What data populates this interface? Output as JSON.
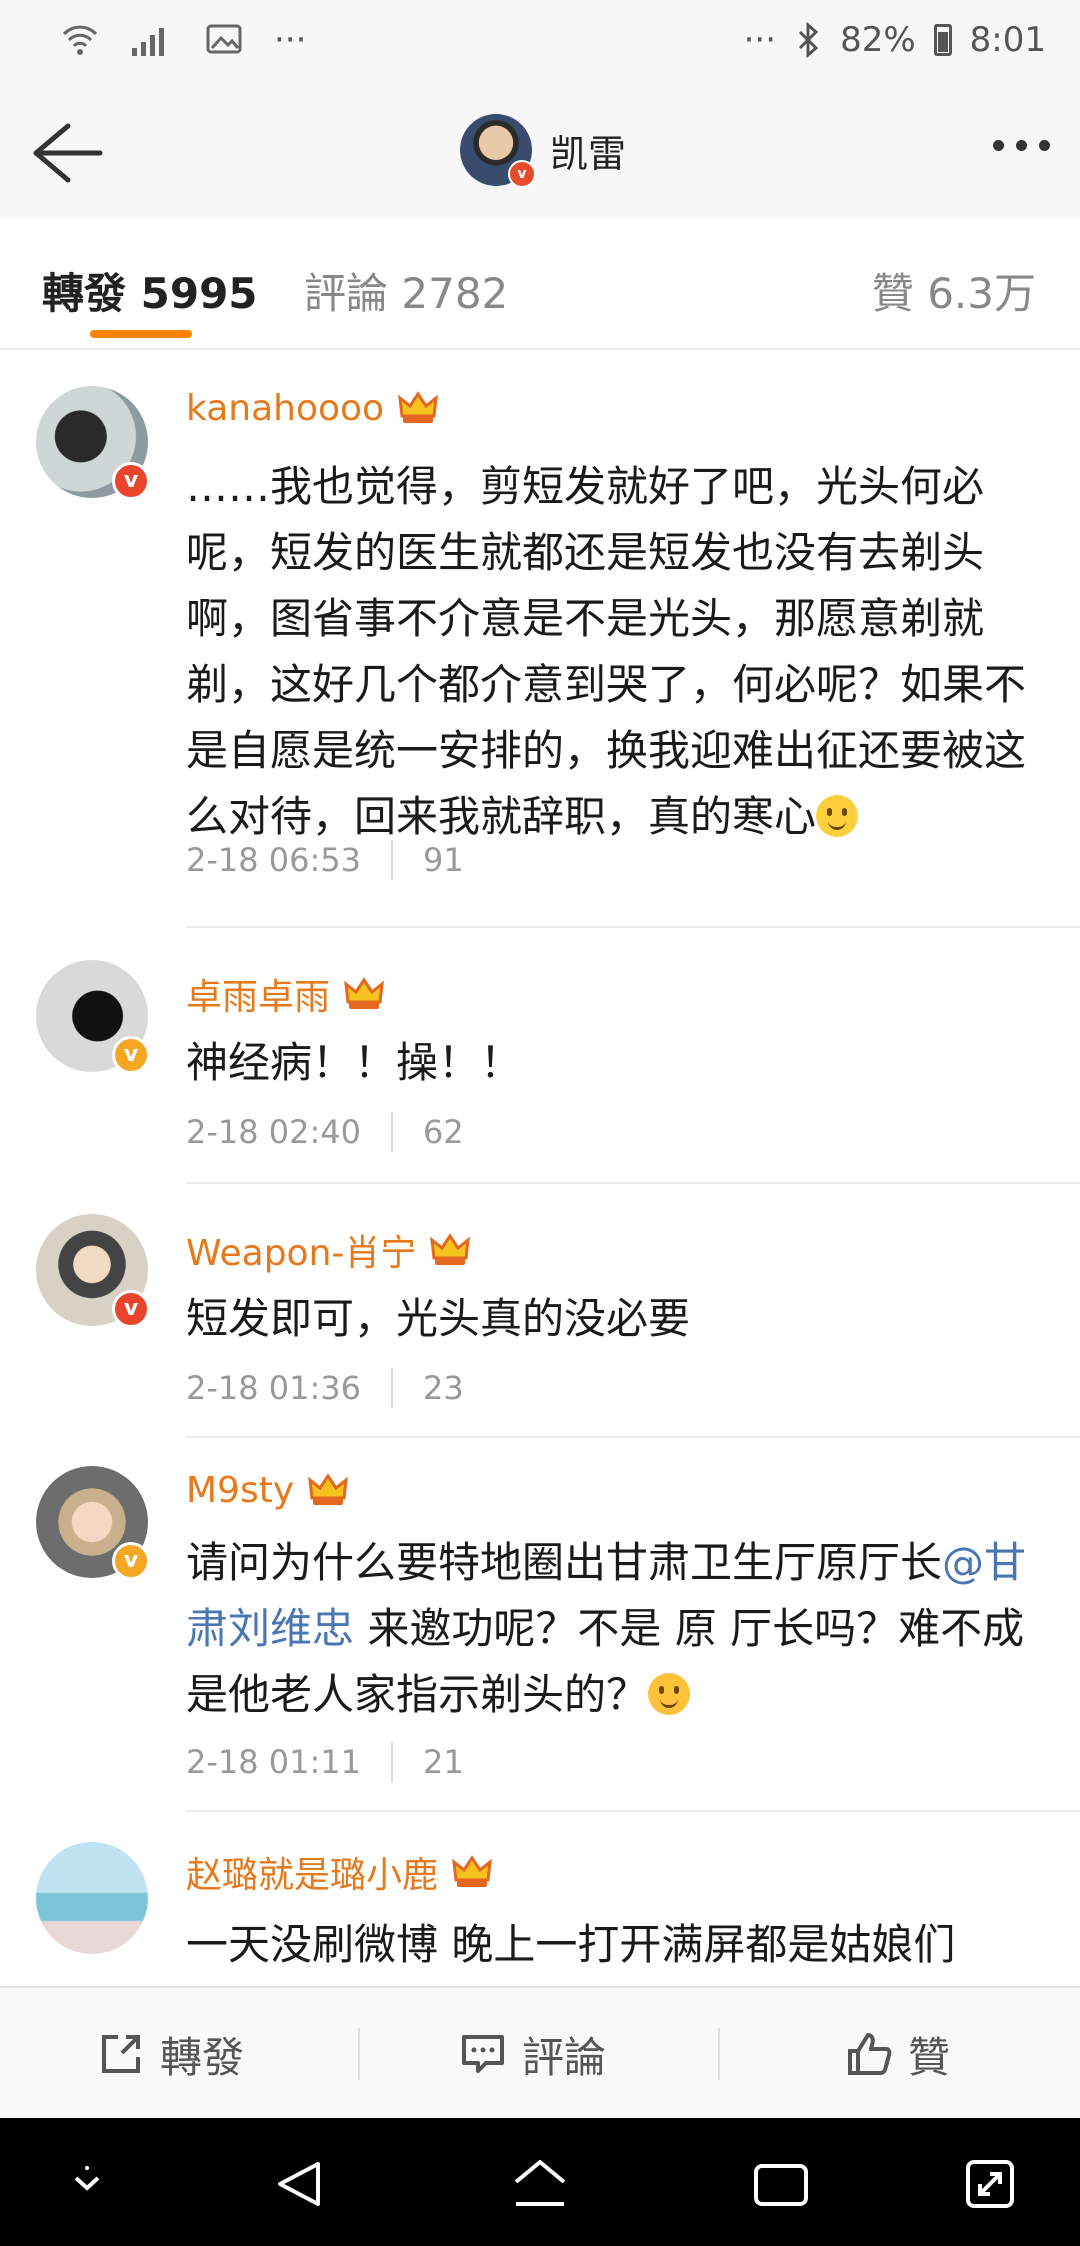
{
  "status_bar": {
    "battery": "82%",
    "time": "8:01",
    "left_dots": "···",
    "right_dots": "···"
  },
  "header": {
    "title": "凯雷"
  },
  "tabs": {
    "repost": {
      "label": "轉發",
      "count": "5995"
    },
    "comment": {
      "label": "評論",
      "count": "2782"
    },
    "like": {
      "label": "贊",
      "count": "6.3万"
    }
  },
  "comments": [
    {
      "name": "kanahoooo",
      "text": "……我也觉得，剪短发就好了吧，光头何必呢，短发的医生就都还是短发也没有去剃头啊，图省事不介意是不是光头，那愿意剃就剃，这好几个都介意到哭了，何必呢？如果不是自愿是统一安排的，换我迎难出征还要被这么对待，回来我就辞职，真的寒心",
      "time": "2-18 06:53",
      "likes": "91",
      "badge": "red"
    },
    {
      "name": "卓雨卓雨",
      "text": "神经病！！操！！",
      "time": "2-18 02:40",
      "likes": "62",
      "badge": "gold"
    },
    {
      "name": "Weapon-肖宁",
      "text": "短发即可，光头真的没必要",
      "time": "2-18 01:36",
      "likes": "23",
      "badge": "red"
    },
    {
      "name": "M9sty",
      "text_before": "请问为什么要特地圈出甘肃卫生厅原厅长",
      "mention": "@甘肃刘维忠",
      "text_after": " 来邀功呢？不是 原 厅长吗？难不成是他老人家指示剃头的？",
      "time": "2-18 01:11",
      "likes": "21",
      "badge": "gold"
    },
    {
      "name": "赵璐就是璐小鹿",
      "text": "一天没刷微博 晚上一打开满屏都是姑娘们",
      "badge": "none"
    }
  ],
  "actions": {
    "repost": "轉發",
    "comment": "評論",
    "like": "贊"
  }
}
